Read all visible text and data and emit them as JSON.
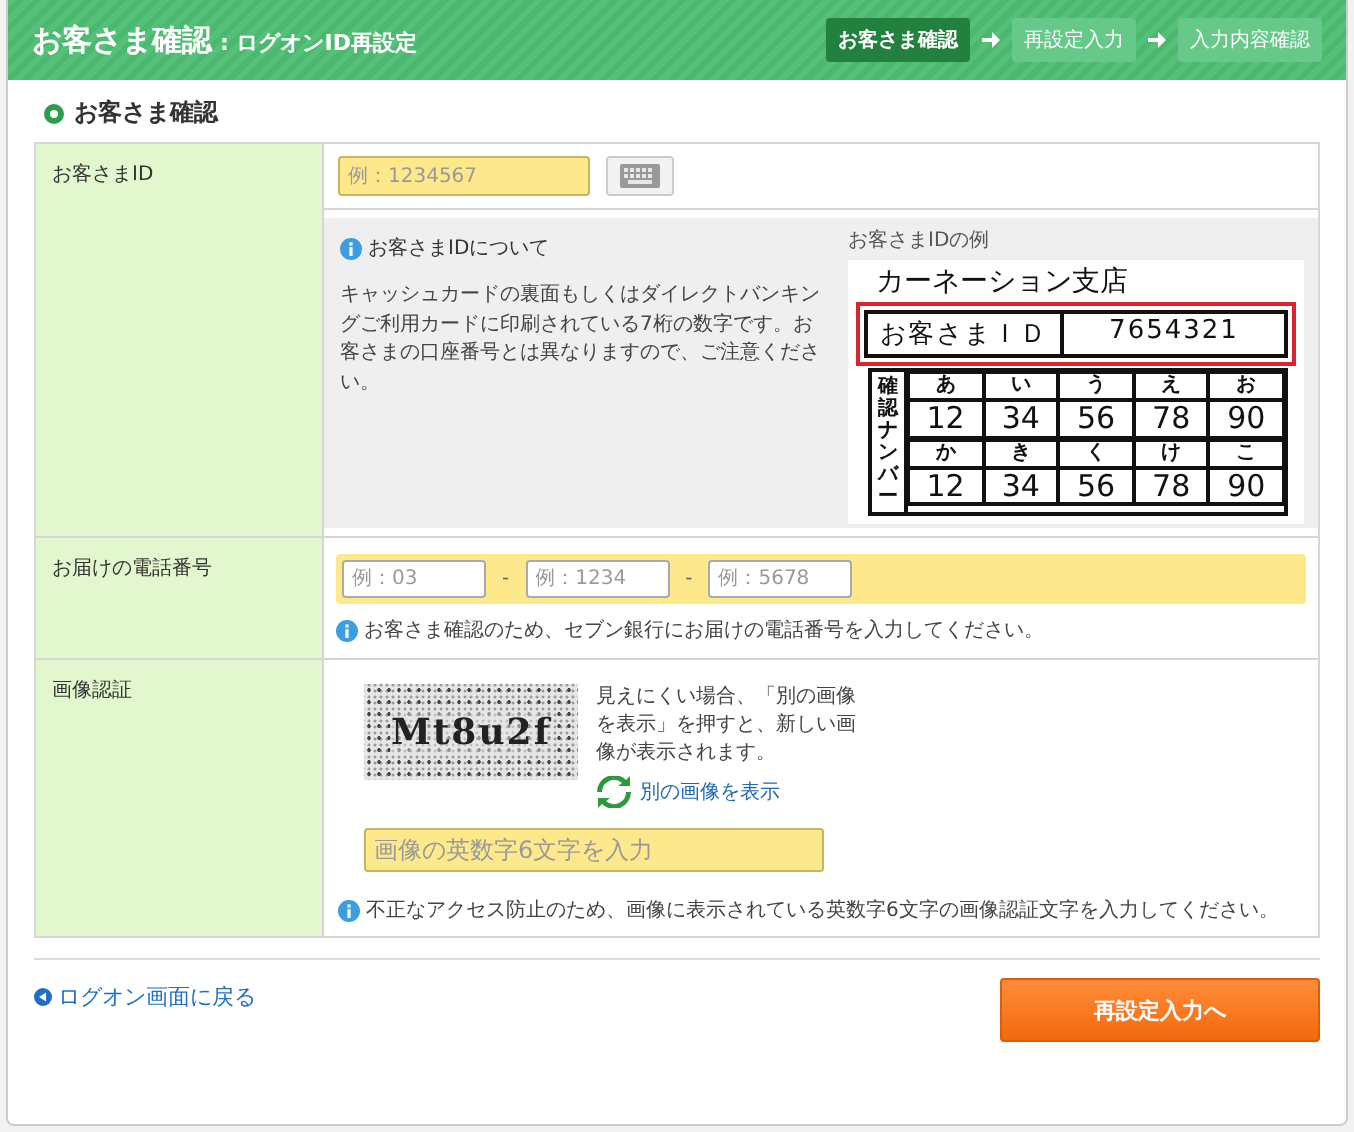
{
  "header": {
    "title": "お客さま確認",
    "subtitle": ": ログオンID再設定",
    "steps": [
      {
        "label": "お客さま確認",
        "selected": true
      },
      {
        "label": "再設定入力",
        "selected": false
      },
      {
        "label": "入力内容確認",
        "selected": false
      }
    ]
  },
  "section_title": "お客さま確認",
  "customer_id": {
    "label": "お客さまID",
    "placeholder": "例：1234567",
    "info_title": "お客さまIDについて",
    "info_text": "キャッシュカードの裏面もしくはダイレクトバンキングご利用カードに印刷されている7桁の数字です。お客さまの口座番号とは異なりますので、ご注意ください。",
    "example_title": "お客さまIDの例",
    "card": {
      "branch": "カーネーション支店",
      "id_label": "お客さまＩＤ",
      "id_value": "7654321",
      "side_label": "確認ナンバー",
      "rows": [
        {
          "keys": [
            "あ",
            "い",
            "う",
            "え",
            "お"
          ],
          "values": [
            "12",
            "34",
            "56",
            "78",
            "90"
          ]
        },
        {
          "keys": [
            "か",
            "き",
            "く",
            "け",
            "こ"
          ],
          "values": [
            "12",
            "34",
            "56",
            "78",
            "90"
          ]
        }
      ]
    }
  },
  "phone": {
    "label": "お届けの電話番号",
    "fields": [
      {
        "placeholder": "例：03"
      },
      {
        "placeholder": "例：1234"
      },
      {
        "placeholder": "例：5678"
      }
    ],
    "separators": [
      "-",
      "-"
    ],
    "note": "お客さま確認のため、セブン銀行にお届けの電話番号を入力してください。"
  },
  "captcha": {
    "label": "画像認証",
    "image_text": "Mt8u2f",
    "hint": "見えにくい場合、「別の画像を表示」を押すと、新しい画像が表示されます。",
    "refresh_link": "別の画像を表示",
    "placeholder": "画像の英数字6文字を入力",
    "note": "不正なアクセス防止のため、画像に表示されている英数字6文字の画像認証文字を入力してください。"
  },
  "footer": {
    "back_link": "ログオン画面に戻る",
    "submit": "再設定入力へ"
  }
}
